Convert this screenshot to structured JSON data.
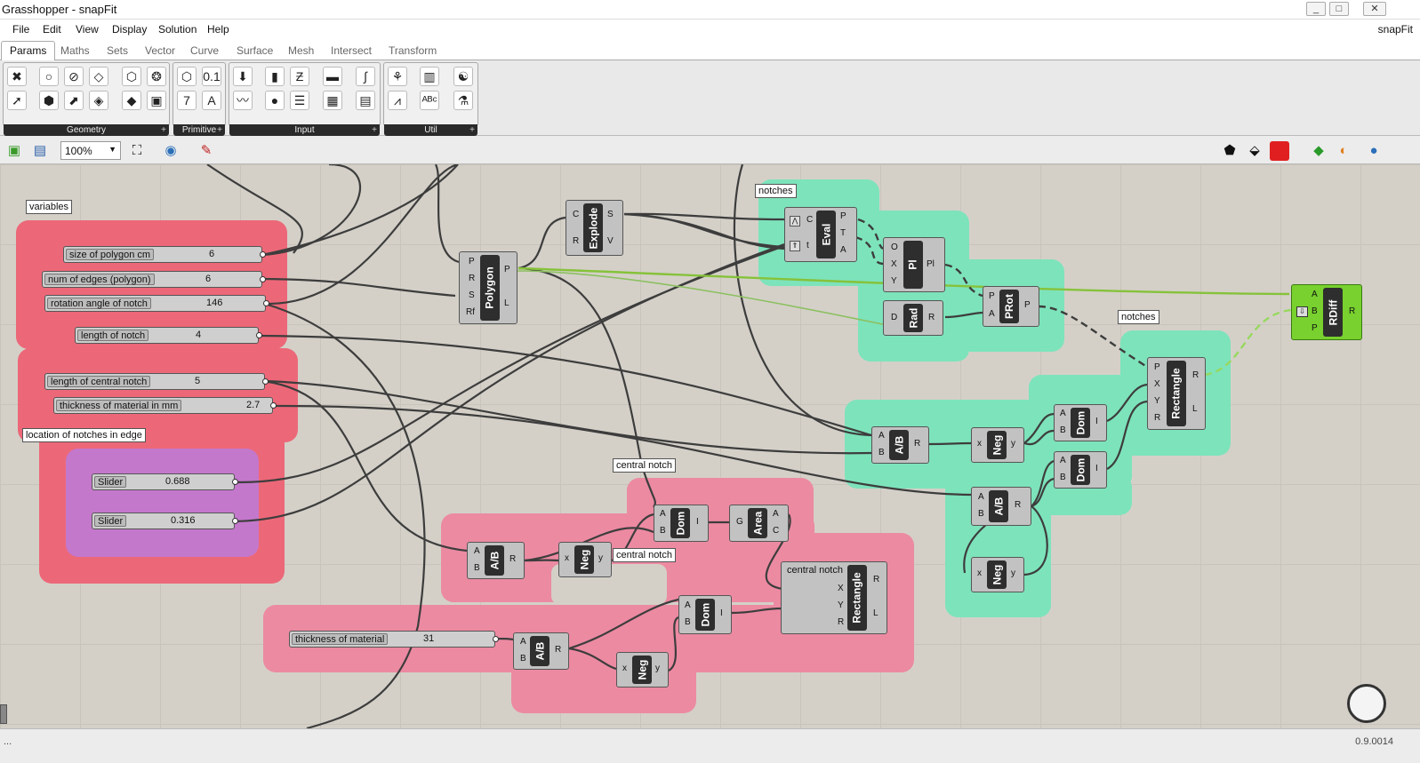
{
  "window": {
    "title": "Grasshopper - snapFit",
    "doc_name": "snapFit",
    "buttons": [
      "_",
      "□",
      "✕"
    ]
  },
  "menu": [
    "File",
    "Edit",
    "View",
    "Display",
    "Solution",
    "Help"
  ],
  "tabs": [
    "Params",
    "Maths",
    "Sets",
    "Vector",
    "Curve",
    "Surface",
    "Mesh",
    "Intersect",
    "Transform"
  ],
  "ribbon_panels": [
    "Geometry",
    "Primitive",
    "Input",
    "Util"
  ],
  "toolbar": {
    "zoom": "100%"
  },
  "groups": {
    "variables": "variables",
    "location": "location of notches in edge",
    "notches_top": "notches",
    "notches_right": "notches",
    "central_notch_top": "central notch",
    "central_notch_mid": "central notch"
  },
  "sliders": [
    {
      "name": "size of polygon cm",
      "value": "6"
    },
    {
      "name": "num of edges (polygon)",
      "value": "6"
    },
    {
      "name": "rotation angle of notch",
      "value": "146"
    },
    {
      "name": "length of notch",
      "value": "4"
    },
    {
      "name": "length of central  notch",
      "value": "5"
    },
    {
      "name": "thickness of material in mm",
      "value": "2.7"
    },
    {
      "name": "Slider",
      "value": "0.688"
    },
    {
      "name": "Slider",
      "value": "0.316"
    },
    {
      "name": "thickness of material",
      "value": "31"
    }
  ],
  "components": {
    "polygon": {
      "name": "Polygon",
      "in": [
        "P",
        "R",
        "S",
        "Rf"
      ],
      "out": [
        "P",
        "L"
      ]
    },
    "explode": {
      "name": "Explode",
      "in": [
        "C",
        "R"
      ],
      "out": [
        "S",
        "V"
      ]
    },
    "eval": {
      "name": "Eval",
      "in": [
        "C",
        "t"
      ],
      "out": [
        "P",
        "T",
        "A"
      ]
    },
    "pl": {
      "name": "Pl",
      "in": [
        "O",
        "X",
        "Y"
      ],
      "out": [
        "Pl"
      ]
    },
    "rad": {
      "name": "Rad",
      "in": [
        "D"
      ],
      "out": [
        "R"
      ]
    },
    "prot": {
      "name": "PRot",
      "in": [
        "P",
        "A"
      ],
      "out": [
        "P"
      ]
    },
    "rect_right": {
      "name": "Rectangle",
      "in": [
        "P",
        "X",
        "Y",
        "R"
      ],
      "out": [
        "R",
        "L"
      ]
    },
    "ab_right1": {
      "name": "A/B",
      "in": [
        "A",
        "B"
      ],
      "out": [
        "R"
      ]
    },
    "neg_right1": {
      "name": "Neg",
      "in": [
        "x"
      ],
      "out": [
        "y"
      ]
    },
    "dom_right1": {
      "name": "Dom",
      "in": [
        "A",
        "B"
      ],
      "out": [
        "I"
      ]
    },
    "dom_right2": {
      "name": "Dom",
      "in": [
        "A",
        "B"
      ],
      "out": [
        "I"
      ]
    },
    "ab_right2": {
      "name": "A/B",
      "in": [
        "A",
        "B"
      ],
      "out": [
        "R"
      ]
    },
    "neg_right2": {
      "name": "Neg",
      "in": [
        "x"
      ],
      "out": [
        "y"
      ]
    },
    "ab_c1": {
      "name": "A/B",
      "in": [
        "A",
        "B"
      ],
      "out": [
        "R"
      ]
    },
    "neg_c1": {
      "name": "Neg",
      "in": [
        "x"
      ],
      "out": [
        "y"
      ]
    },
    "dom_c1": {
      "name": "Dom",
      "in": [
        "A",
        "B"
      ],
      "out": [
        "I"
      ]
    },
    "area": {
      "name": "Area",
      "in": [
        "G"
      ],
      "out": [
        "A",
        "C"
      ]
    },
    "rect_c": {
      "name": "Rectangle",
      "title": "central notch",
      "in": [
        "X",
        "Y",
        "R"
      ],
      "out": [
        "R",
        "L"
      ]
    },
    "dom_c2": {
      "name": "Dom",
      "in": [
        "A",
        "B"
      ],
      "out": [
        "I"
      ]
    },
    "ab_c2": {
      "name": "A/B",
      "in": [
        "A",
        "B"
      ],
      "out": [
        "R"
      ]
    },
    "neg_c2": {
      "name": "Neg",
      "in": [
        "x"
      ],
      "out": [
        "y"
      ]
    },
    "rdiff": {
      "name": "RDiff",
      "in": [
        "A",
        "B",
        "P"
      ],
      "out": [
        "R"
      ]
    }
  },
  "status": {
    "left": "...",
    "version": "0.9.0014"
  }
}
